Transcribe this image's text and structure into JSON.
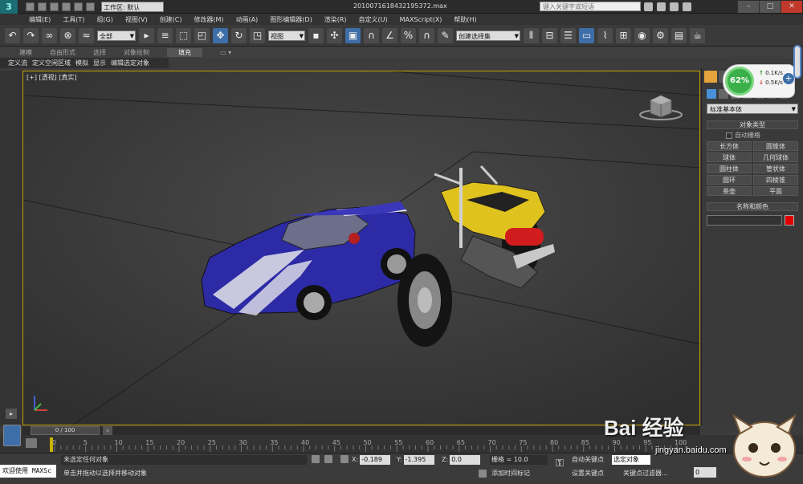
{
  "window": {
    "file_title": "20100716184321953​72.max",
    "workspace": "工作区: 默认",
    "search_placeholder": "键入关键字或短语"
  },
  "menu": [
    "编辑(E)",
    "工具(T)",
    "组(G)",
    "视图(V)",
    "创建(C)",
    "修改器(M)",
    "动画(A)",
    "图形编辑器(D)",
    "渲染(R)",
    "自定义(U)",
    "MAXScript(X)",
    "帮助(H)"
  ],
  "toolbar": {
    "filter": "全部",
    "refcoord": "视图",
    "named_selection": "创建选择集"
  },
  "ribbon": {
    "tabs": [
      "建模",
      "自由形式",
      "选择",
      "对象绘制",
      "填充"
    ],
    "selected": "填充",
    "sub": [
      "定义流",
      "定义空闲区域",
      "模拟",
      "显示",
      "编辑选定对象"
    ]
  },
  "viewport": {
    "label": "[+] [透视] [真实]"
  },
  "command_panel": {
    "category": "标准基本体",
    "object_type_header": "对象类型",
    "autogrid": "自动栅格",
    "objects": [
      "长方体",
      "圆锥体",
      "球体",
      "几何球体",
      "圆柱体",
      "管状体",
      "圆环",
      "四棱锥",
      "茶壶",
      "平面"
    ],
    "name_color_header": "名称和颜色",
    "object_color": "#e00000"
  },
  "network": {
    "percent": "62%",
    "up": "0.1K/s",
    "down": "0.5K/s"
  },
  "timeline": {
    "position": "0 / 100",
    "ticks": [
      "0",
      "5",
      "10",
      "15",
      "20",
      "25",
      "30",
      "35",
      "40",
      "45",
      "50",
      "55",
      "60",
      "65",
      "70",
      "75",
      "80",
      "85",
      "90",
      "95",
      "100"
    ]
  },
  "status": {
    "welcome": "欢迎使用 MAXSc",
    "line1": "未选定任何对象",
    "line2": "单击并拖动以选择并移动对象",
    "x": "-0.189",
    "y": "-1.395",
    "z": "0.0",
    "x_label": "X:",
    "y_label": "Y:",
    "z_label": "Z:",
    "grid": "栅格 = 10.0",
    "add_time_tag": "添加时间标记",
    "auto_key": "自动关键点",
    "set_key": "设置关键点",
    "selected_set": "选定对象",
    "key_filters": "关键点过滤器...",
    "frame": "0"
  },
  "watermark": {
    "brand": "Bai 经验",
    "url": "jingyan.baidu.com"
  }
}
